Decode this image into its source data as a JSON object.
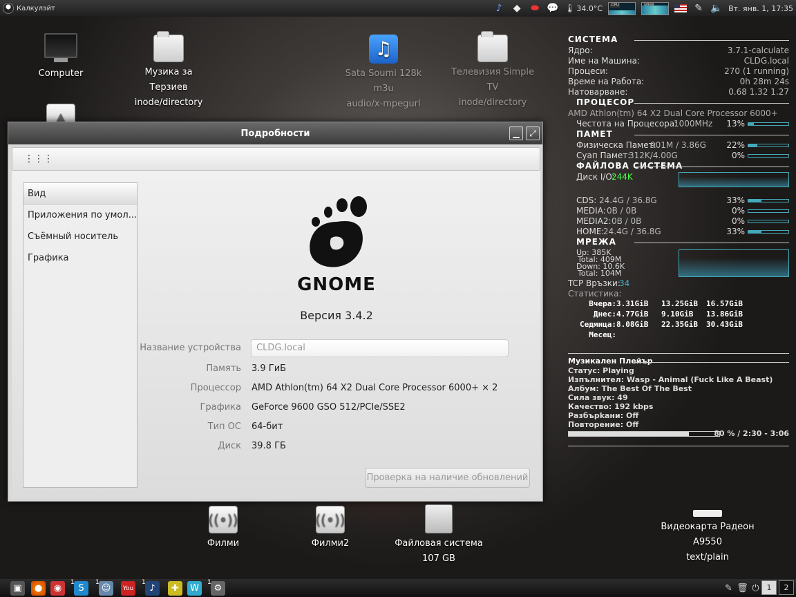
{
  "top_panel": {
    "app_name": "Калкулэйт",
    "temperature": "34.0°C",
    "cpu_label": "CPU",
    "mem_label": "MEM",
    "clock": "Вт. янв.  1, 17:35"
  },
  "desktop": {
    "computer": "Computer",
    "music_folder_line1": "Музика за Терзиев",
    "music_folder_line2": "inode/directory",
    "sata_line1": "Sata Soumi 128k",
    "sata_line2": "m3u",
    "sata_line3": "audio/x-mpegurl",
    "tv_line1": "Телевизия Simple",
    "tv_line2": "TV",
    "tv_line3": "inode/directory",
    "filmi": "Филми",
    "filmi2": "Филми2",
    "fs_line1": "Файловая система",
    "fs_line2": "107 GB",
    "radeon_line1": "Видеокарта Радеон",
    "radeon_line2": "A9550",
    "radeon_line3": "text/plain"
  },
  "window": {
    "title": "Подробности",
    "sidebar": [
      "Вид",
      "Приложения по умол...",
      "Съёмный носитель",
      "Графика"
    ],
    "gnome_word": "GNOME",
    "version": "Версия 3.4.2",
    "device_label": "Название устройства",
    "device_value": "CLDG.local",
    "rows": [
      {
        "k": "Память",
        "v": "3.9 ГиБ"
      },
      {
        "k": "Процессор",
        "v": "AMD Athlon(tm) 64 X2 Dual Core Processor 6000+ × 2"
      },
      {
        "k": "Графика",
        "v": "GeForce 9600 GSO 512/PCIe/SSE2"
      },
      {
        "k": "Тип ОС",
        "v": "64-бит"
      },
      {
        "k": "Диск",
        "v": "39.8 ГБ"
      }
    ],
    "update_button": "Проверка на наличие обновлений"
  },
  "conky": {
    "system_h": "СИСТЕМА",
    "kernel_l": "Ядро:",
    "kernel_v": "3.7.1-calculate",
    "host_l": "Име на Машина:",
    "host_v": "CLDG.local",
    "proc_l": "Процеси:",
    "proc_v": "270 (1 running)",
    "uptime_l": "Време на Работа:",
    "uptime_v": "0h 28m 24s",
    "load_l": "Натоварване:",
    "load_v": "0.68 1.32 1.27",
    "cpu_h": "ПРОЦЕСОР",
    "cpu_name": "AMD Athlon(tm) 64 X2 Dual Core Processor 6000+",
    "cpu_freq_l": "Честота на Процесора:",
    "cpu_freq_v": "1000MHz",
    "cpu_pct": "13%",
    "cpu_frac": 0.13,
    "mem_h": "ПАМЕТ",
    "phys_l": "Физическа Памет:",
    "phys_v": "901M / 3.86G",
    "phys_pct": "22%",
    "phys_frac": 0.22,
    "swap_l": "Суап Памет:",
    "swap_v": "312K/4.00G",
    "swap_pct": "0%",
    "swap_frac": 0.0,
    "fs_h": "ФАЙЛОВА СИСТЕМА",
    "disk_io_l": "Диск I/O:",
    "disk_io_v": "244K",
    "fs_rows": [
      {
        "l": "CDS:",
        "v": "24.4G / 36.8G",
        "pct": "33%",
        "frac": 0.33
      },
      {
        "l": "MEDIA:",
        "v": "0B / 0B",
        "pct": "0%",
        "frac": 0.0
      },
      {
        "l": "MEDIA2:",
        "v": "0B / 0B",
        "pct": "0%",
        "frac": 0.0
      },
      {
        "l": "HOME:",
        "v": "24.4G / 36.8G",
        "pct": "33%",
        "frac": 0.33
      }
    ],
    "net_h": "МРЕЖА",
    "up": "Up: 385K",
    "up_total": "Total: 409M",
    "down": "Down: 10.6K",
    "down_total": "Total: 104M",
    "tcp_l": "TCP Връзки:",
    "tcp_v": "34",
    "stats_l": "Статистика:",
    "stats": [
      {
        "l": "Вчера:",
        "a": "3.31GiB",
        "b": "13.25GiB",
        "c": "16.57GiB"
      },
      {
        "l": "Днес:",
        "a": "4.77GiB",
        "b": "9.10GiB",
        "c": "13.86GiB"
      },
      {
        "l": "Седмица:",
        "a": "8.08GiB",
        "b": "22.35GiB",
        "c": "30.43GiB"
      },
      {
        "l": "Месец:",
        "a": "",
        "b": "",
        "c": ""
      }
    ],
    "player_h": "Музикален Плейър",
    "player_lines": [
      "Статус: Playing",
      "Изпълнител: Wasp - Animal (Fuck Like A Beast)",
      "Албум: The Best Of The Best",
      "Сила звук: 49",
      "Качество: 192 kbps",
      "Разбърkани: Off",
      "Повторение: Off"
    ],
    "progress_frac": 0.8,
    "progress_text": "80 % / 2:30 - 3:06"
  },
  "bottom_panel": {
    "ws1": "1",
    "ws2": "2",
    "badge": "1"
  }
}
